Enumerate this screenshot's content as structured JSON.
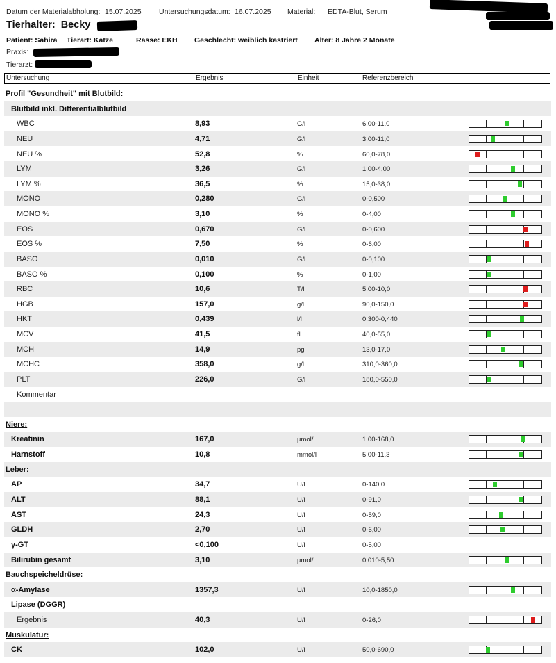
{
  "header": {
    "pickup_label": "Datum der Materialabholung:",
    "pickup_date": "15.07.2025",
    "exam_label": "Untersuchungsdatum:",
    "exam_date": "16.07.2025",
    "material_label": "Material:",
    "material_value": "EDTA-Blut, Serum",
    "owner_label": "Tierhalter:",
    "owner_name": "Becky",
    "patient": "Patient: Sahira",
    "species": "Tierart: Katze",
    "breed": "Rasse: EKH",
    "sex": "Geschlecht: weiblich kastriert",
    "age": "Alter: 8 Jahre 2 Monate",
    "practice_label": "Praxis:",
    "vet_label": "Tierarzt:"
  },
  "columns": {
    "test": "Untersuchung",
    "result": "Ergebnis",
    "unit": "Einheit",
    "reference": "Referenzbereich"
  },
  "colors": {
    "shade": "#ebebeb",
    "ok": "#2ecc2e",
    "out_of_range": "#dd1c1c"
  },
  "rows": [
    {
      "kind": "section",
      "name": "Profil \"Gesundheit\" mit Blutbild:"
    },
    {
      "kind": "group",
      "name": "Blutbild inkl. Differentialblutbild"
    },
    {
      "kind": "test",
      "name": "WBC",
      "value": "8,93",
      "unit": "G/l",
      "ref": "6,00-11,0",
      "level": 0.52,
      "status": "ok"
    },
    {
      "kind": "test",
      "name": "NEU",
      "value": "4,71",
      "unit": "G/l",
      "ref": "3,00-11,0",
      "level": 0.33,
      "status": "ok"
    },
    {
      "kind": "test",
      "name": "NEU %",
      "value": "52,8",
      "unit": "%",
      "ref": "60,0-78,0",
      "level": 0.12,
      "status": "low"
    },
    {
      "kind": "test",
      "name": "LYM",
      "value": "3,26",
      "unit": "G/l",
      "ref": "1,00-4,00",
      "level": 0.61,
      "status": "ok"
    },
    {
      "kind": "test",
      "name": "LYM %",
      "value": "36,5",
      "unit": "%",
      "ref": "15,0-38,0",
      "level": 0.7,
      "status": "ok"
    },
    {
      "kind": "test",
      "name": "MONO",
      "value": "0,280",
      "unit": "G/l",
      "ref": "0-0,500",
      "level": 0.5,
      "status": "ok"
    },
    {
      "kind": "test",
      "name": "MONO %",
      "value": "3,10",
      "unit": "%",
      "ref": "0-4,00",
      "level": 0.61,
      "status": "ok"
    },
    {
      "kind": "test",
      "name": "EOS",
      "value": "0,670",
      "unit": "G/l",
      "ref": "0-0,600",
      "level": 0.78,
      "status": "high"
    },
    {
      "kind": "test",
      "name": "EOS %",
      "value": "7,50",
      "unit": "%",
      "ref": "0-6,00",
      "level": 0.8,
      "status": "high"
    },
    {
      "kind": "test",
      "name": "BASO",
      "value": "0,010",
      "unit": "G/l",
      "ref": "0-0,100",
      "level": 0.27,
      "status": "ok"
    },
    {
      "kind": "test",
      "name": "BASO %",
      "value": "0,100",
      "unit": "%",
      "ref": "0-1,00",
      "level": 0.27,
      "status": "ok"
    },
    {
      "kind": "test",
      "name": "RBC",
      "value": "10,6",
      "unit": "T/l",
      "ref": "5,00-10,0",
      "level": 0.78,
      "status": "high"
    },
    {
      "kind": "test",
      "name": "HGB",
      "value": "157,0",
      "unit": "g/l",
      "ref": "90,0-150,0",
      "level": 0.78,
      "status": "high"
    },
    {
      "kind": "test",
      "name": "HKT",
      "value": "0,439",
      "unit": "l/l",
      "ref": "0,300-0,440",
      "level": 0.73,
      "status": "ok"
    },
    {
      "kind": "test",
      "name": "MCV",
      "value": "41,5",
      "unit": "fl",
      "ref": "40,0-55,0",
      "level": 0.27,
      "status": "ok"
    },
    {
      "kind": "test",
      "name": "MCH",
      "value": "14,9",
      "unit": "pg",
      "ref": "13,0-17,0",
      "level": 0.47,
      "status": "ok"
    },
    {
      "kind": "test",
      "name": "MCHC",
      "value": "358,0",
      "unit": "g/l",
      "ref": "310,0-360,0",
      "level": 0.72,
      "status": "ok"
    },
    {
      "kind": "test",
      "name": "PLT",
      "value": "226,0",
      "unit": "G/l",
      "ref": "180,0-550,0",
      "level": 0.28,
      "status": "ok"
    },
    {
      "kind": "comment",
      "name": "Kommentar"
    },
    {
      "kind": "blank"
    },
    {
      "kind": "section",
      "name": "Niere:"
    },
    {
      "kind": "btest",
      "name": "Kreatinin",
      "value": "167,0",
      "unit": "µmol/l",
      "ref": "1,00-168,0",
      "level": 0.74,
      "status": "ok"
    },
    {
      "kind": "btest",
      "name": "Harnstoff",
      "value": "10,8",
      "unit": "mmol/l",
      "ref": "5,00-11,3",
      "level": 0.71,
      "status": "ok"
    },
    {
      "kind": "section",
      "name": "Leber:"
    },
    {
      "kind": "btest",
      "name": "AP",
      "value": "34,7",
      "unit": "U/l",
      "ref": "0-140,0",
      "level": 0.36,
      "status": "ok"
    },
    {
      "kind": "btest",
      "name": "ALT",
      "value": "88,1",
      "unit": "U/l",
      "ref": "0-91,0",
      "level": 0.72,
      "status": "ok"
    },
    {
      "kind": "btest",
      "name": "AST",
      "value": "24,3",
      "unit": "U/l",
      "ref": "0-59,0",
      "level": 0.44,
      "status": "ok"
    },
    {
      "kind": "btest",
      "name": "GLDH",
      "value": "2,70",
      "unit": "U/l",
      "ref": "0-6,00",
      "level": 0.46,
      "status": "ok"
    },
    {
      "kind": "btest",
      "name": "γ-GT",
      "value": "<0,100",
      "unit": "U/l",
      "ref": "0-5,00"
    },
    {
      "kind": "btest",
      "name": "Bilirubin gesamt",
      "value": "3,10",
      "unit": "µmol/l",
      "ref": "0,010-5,50",
      "level": 0.52,
      "status": "ok"
    },
    {
      "kind": "section",
      "name": "Bauchspeicheldrüse:"
    },
    {
      "kind": "btest",
      "name": "α-Amylase",
      "value": "1357,3",
      "unit": "U/l",
      "ref": "10,0-1850,0",
      "level": 0.61,
      "status": "ok"
    },
    {
      "kind": "group",
      "name": "Lipase (DGGR)"
    },
    {
      "kind": "test",
      "name": "Ergebnis",
      "value": "40,3",
      "unit": "U/l",
      "ref": "0-26,0",
      "level": 0.88,
      "status": "high"
    },
    {
      "kind": "section",
      "name": "Muskulatur:"
    },
    {
      "kind": "btest",
      "name": "CK",
      "value": "102,0",
      "unit": "U/l",
      "ref": "50,0-690,0",
      "level": 0.26,
      "status": "ok"
    }
  ]
}
